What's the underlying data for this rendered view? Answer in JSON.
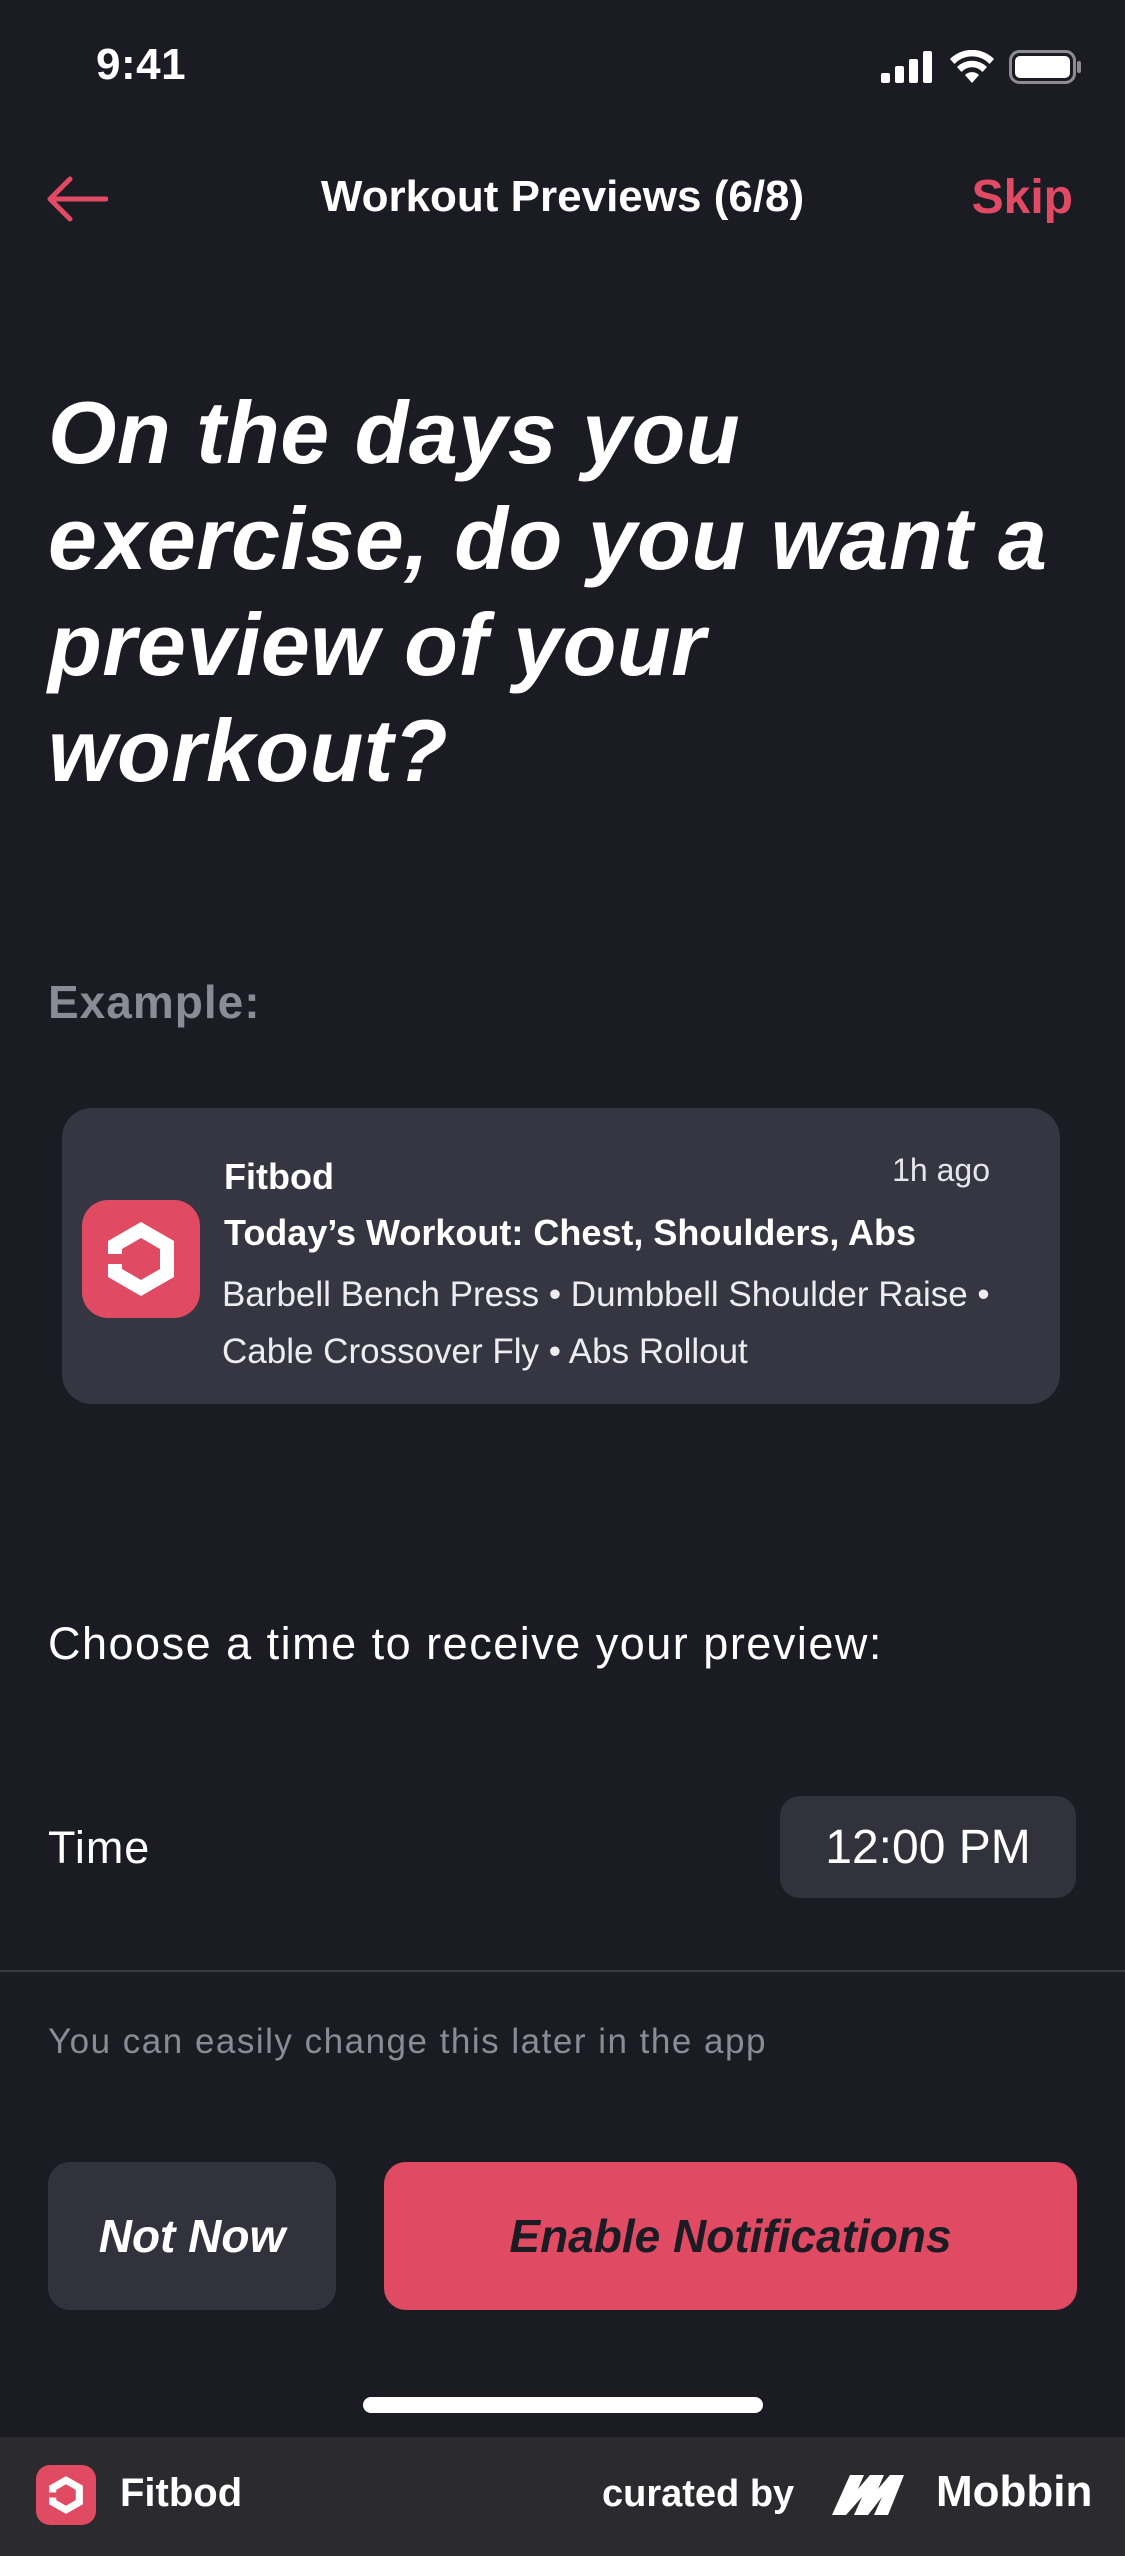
{
  "status_bar": {
    "time": "9:41"
  },
  "nav": {
    "title": "Workout Previews (6/8)",
    "skip_label": "Skip"
  },
  "headline": "On the days you exercise, do you want a preview of your workout?",
  "example_label": "Example:",
  "notification": {
    "app_name": "Fitbod",
    "time_ago": "1h ago",
    "title": "Today’s Workout: Chest, Shoulders, Abs",
    "body": "Barbell Bench Press • Dumbbell Shoulder Raise • Cable Crossover Fly • Abs Rollout"
  },
  "choose_text": "Choose a time to receive your preview:",
  "time_row": {
    "label": "Time",
    "value": "12:00 PM"
  },
  "hint": "You can easily change this later in the app",
  "buttons": {
    "not_now": "Not Now",
    "enable": "Enable Notifications"
  },
  "footer": {
    "app_name": "Fitbod",
    "curated_by": "curated by",
    "brand": "Mobbin"
  },
  "colors": {
    "background": "#1b1b23",
    "accent": "#e04a63",
    "card": "#363642",
    "muted": "#8b8b96"
  },
  "icons": [
    "back-arrow-icon",
    "signal-icon",
    "wifi-icon",
    "battery-icon",
    "fitbod-logo-icon",
    "mobbin-logo-icon"
  ]
}
